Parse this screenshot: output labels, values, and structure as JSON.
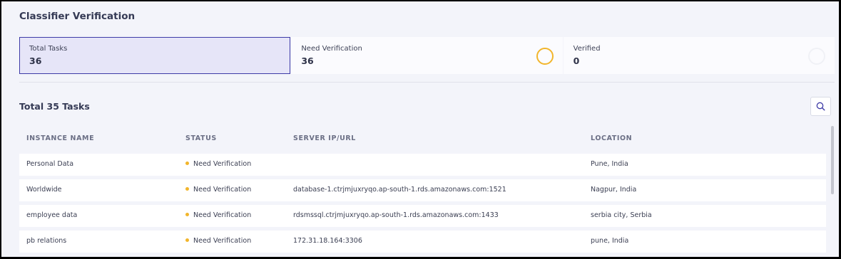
{
  "header": {
    "title": "Classifier Verification"
  },
  "stats": [
    {
      "label": "Total Tasks",
      "value": "36"
    },
    {
      "label": "Need Verification",
      "value": "36"
    },
    {
      "label": "Verified",
      "value": "0"
    }
  ],
  "tasks": {
    "title": "Total 35 Tasks",
    "columns": [
      "INSTANCE NAME",
      "STATUS",
      "SERVER IP/URL",
      "LOCATION"
    ],
    "rows": [
      {
        "name": "Personal Data",
        "status": "Need Verification",
        "server": "",
        "location": "Pune, India"
      },
      {
        "name": "Worldwide",
        "status": "Need Verification",
        "server": "database-1.ctrjmjuxryqo.ap-south-1.rds.amazonaws.com:1521",
        "location": "Nagpur, India"
      },
      {
        "name": "employee data",
        "status": "Need Verification",
        "server": "rdsmssql.ctrjmjuxryqo.ap-south-1.rds.amazonaws.com:1433",
        "location": "serbia city, Serbia"
      },
      {
        "name": "pb relations",
        "status": "Need Verification",
        "server": "172.31.18.164:3306",
        "location": "pune, India"
      }
    ]
  },
  "colors": {
    "accent": "#3d3aa6",
    "status_pending": "#f2b52b"
  }
}
